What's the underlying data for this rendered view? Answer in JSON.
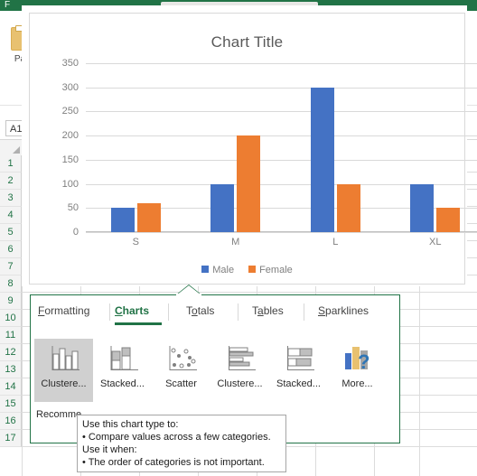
{
  "app": {
    "file_tab_label": "F",
    "paste_label": "Pa",
    "name_box_value": "A1"
  },
  "grid": {
    "row_headers": [
      "1",
      "2",
      "3",
      "4",
      "5",
      "6",
      "7",
      "8",
      "9",
      "10",
      "11",
      "12",
      "13",
      "14",
      "15",
      "16",
      "17"
    ]
  },
  "chart": {
    "title": "Chart Title",
    "colors": {
      "male": "#4472c4",
      "female": "#ed7d31",
      "gridline": "#d9d9d9",
      "text": "#7f7f7f"
    }
  },
  "chart_data": {
    "type": "bar",
    "title": "Chart Title",
    "xlabel": "",
    "ylabel": "",
    "categories": [
      "S",
      "M",
      "L",
      "XL"
    ],
    "yticks": [
      0,
      50,
      100,
      150,
      200,
      250,
      300,
      350
    ],
    "ylim": [
      0,
      350
    ],
    "grid": true,
    "legend": "bottom",
    "series": [
      {
        "name": "Male",
        "color": "#4472c4",
        "values": [
          50,
          100,
          300,
          100
        ]
      },
      {
        "name": "Female",
        "color": "#ed7d31",
        "values": [
          60,
          200,
          100,
          50
        ]
      }
    ]
  },
  "quick_analysis": {
    "tabs": [
      {
        "label": "Formatting",
        "accel": "F",
        "active": false
      },
      {
        "label": "Charts",
        "accel": "C",
        "active": true
      },
      {
        "label": "Totals",
        "accel": "o",
        "active": false
      },
      {
        "label": "Tables",
        "accel": "a",
        "active": false
      },
      {
        "label": "Sparklines",
        "accel": "S",
        "active": false
      }
    ],
    "gallery": [
      {
        "label": "Clustere...",
        "icon": "clustered-column-icon",
        "selected": true
      },
      {
        "label": "Stacked...",
        "icon": "stacked-column-icon",
        "selected": false
      },
      {
        "label": "Scatter",
        "icon": "scatter-icon",
        "selected": false
      },
      {
        "label": "Clustere...",
        "icon": "clustered-bar-icon",
        "selected": false
      },
      {
        "label": "Stacked...",
        "icon": "stacked-bar-icon",
        "selected": false
      },
      {
        "label": "More...",
        "icon": "more-charts-icon",
        "selected": false
      }
    ],
    "recommended_label": "Recomme",
    "tooltip": {
      "line1": "Use this chart type to:",
      "line2": "• Compare values across a few categories.",
      "line3": "Use it when:",
      "line4": "• The order of categories is not important."
    }
  }
}
